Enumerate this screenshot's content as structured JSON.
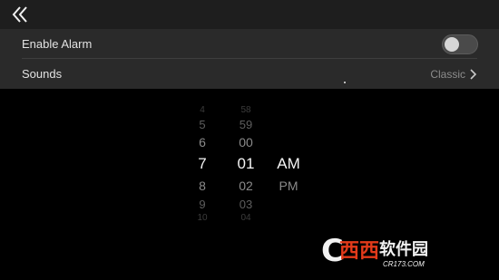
{
  "header": {
    "back_icon": "back-chevron-icon"
  },
  "settings": {
    "enable_alarm": {
      "label": "Enable Alarm",
      "enabled": false
    },
    "sounds": {
      "label": "Sounds",
      "value": "Classic"
    }
  },
  "picker": {
    "hours": [
      "4",
      "5",
      "6",
      "7",
      "8",
      "9",
      "10"
    ],
    "minutes": [
      "58",
      "59",
      "00",
      "01",
      "02",
      "03",
      "04"
    ],
    "ampm": [
      "AM",
      "PM"
    ],
    "selected": {
      "hour": "7",
      "minute": "01",
      "ampm": "AM"
    }
  },
  "watermark": {
    "c_letter": "C",
    "logo": "西西",
    "name": "软件园",
    "url": "CR173.COM"
  }
}
